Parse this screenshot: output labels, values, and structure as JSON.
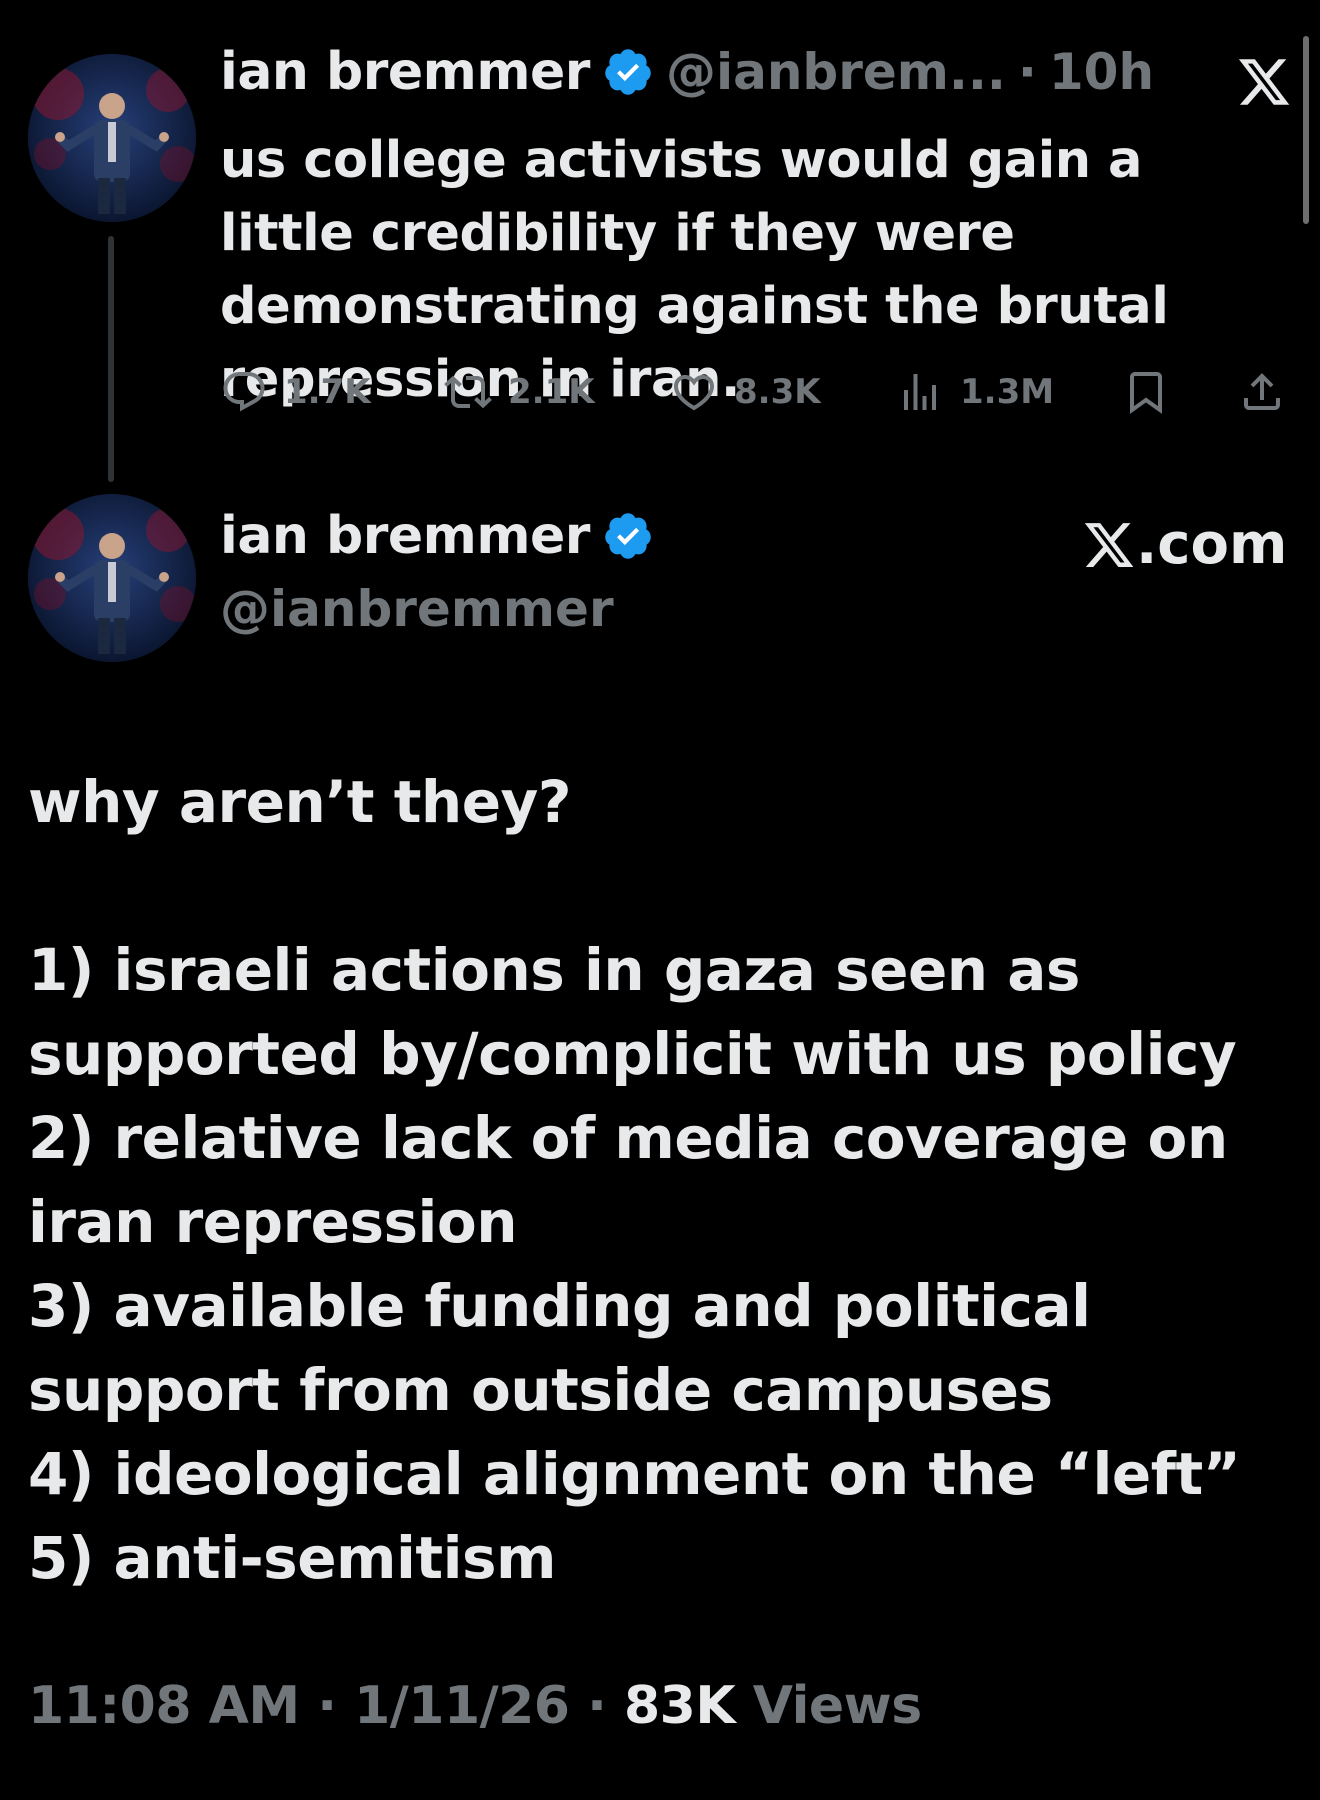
{
  "tweet1": {
    "author_name": "ian bremmer",
    "handle": "@ianbrem...",
    "dot": "·",
    "age": "10h",
    "text": "us college activists would gain a little credibility if they were demonstrating against the brutal repression in iran.",
    "replies": "1.7K",
    "retweets": "2.1K",
    "likes": "8.3K",
    "views": "1.3M"
  },
  "tweet2": {
    "author_name": "ian bremmer",
    "handle": "@ianbremmer",
    "source": ".com",
    "lines": [
      "why aren’t they?",
      "",
      "1) israeli actions in gaza seen as",
      "supported by/complicit with us policy",
      "2) relative lack of media coverage on",
      "iran repression",
      "3) available funding and political",
      "support from outside campuses",
      "4) ideological alignment on the “left”",
      "5) anti-semitism"
    ],
    "time": "11:08 AM",
    "sep": " · ",
    "date": "1/11/26",
    "views_count": "83K",
    "views_label": " Views"
  },
  "colors": {
    "background": "#000000",
    "text": "#e7e9ea",
    "muted": "#71767b",
    "verified": "#1d9bf0"
  },
  "icons": [
    "verified-badge-icon",
    "x-logo-icon",
    "reply-icon",
    "retweet-icon",
    "like-icon",
    "views-icon",
    "bookmark-icon",
    "share-icon"
  ]
}
